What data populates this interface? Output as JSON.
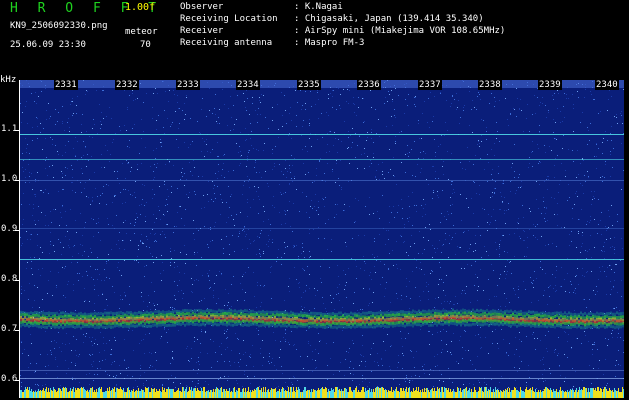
{
  "header": {
    "app_title": "H R O F F T",
    "version": "1.00f",
    "filename": "KN9_2506092330.png",
    "datetime": "25.06.09 23:30",
    "meteor_label": "meteor",
    "meteor_count": "70"
  },
  "info": {
    "observer_label": "Observer",
    "observer_value": ": K.Nagai",
    "location_label": "Receiving Location",
    "location_value": ": Chigasaki, Japan (139.414 35.340)",
    "receiver_label": "Receiver",
    "receiver_value": ": AirSpy mini (Miakejima VOR 108.65MHz)",
    "antenna_label": "Receiving antenna",
    "antenna_value": ": Maspro FM-3"
  },
  "axis": {
    "unit_label": "kHz",
    "y_ticks": [
      "1.1",
      "1.0",
      "0.9",
      "0.8",
      "0.7",
      "0.6"
    ],
    "x_ticks": [
      "2331",
      "2332",
      "2333",
      "2334",
      "2335",
      "2336",
      "2337",
      "2338",
      "2339",
      "2340"
    ]
  },
  "colors": {
    "background": "#000000",
    "title_green": "#1fd21f",
    "version_yellow": "#ffff00",
    "plot_blue": "#0a1e7a",
    "noise_light": "#3b6bd6",
    "carrier_cyan": "#4fd8e8",
    "band_green": "#2ec33a",
    "band_red": "#e04020",
    "band_yellow": "#f0e020"
  }
}
